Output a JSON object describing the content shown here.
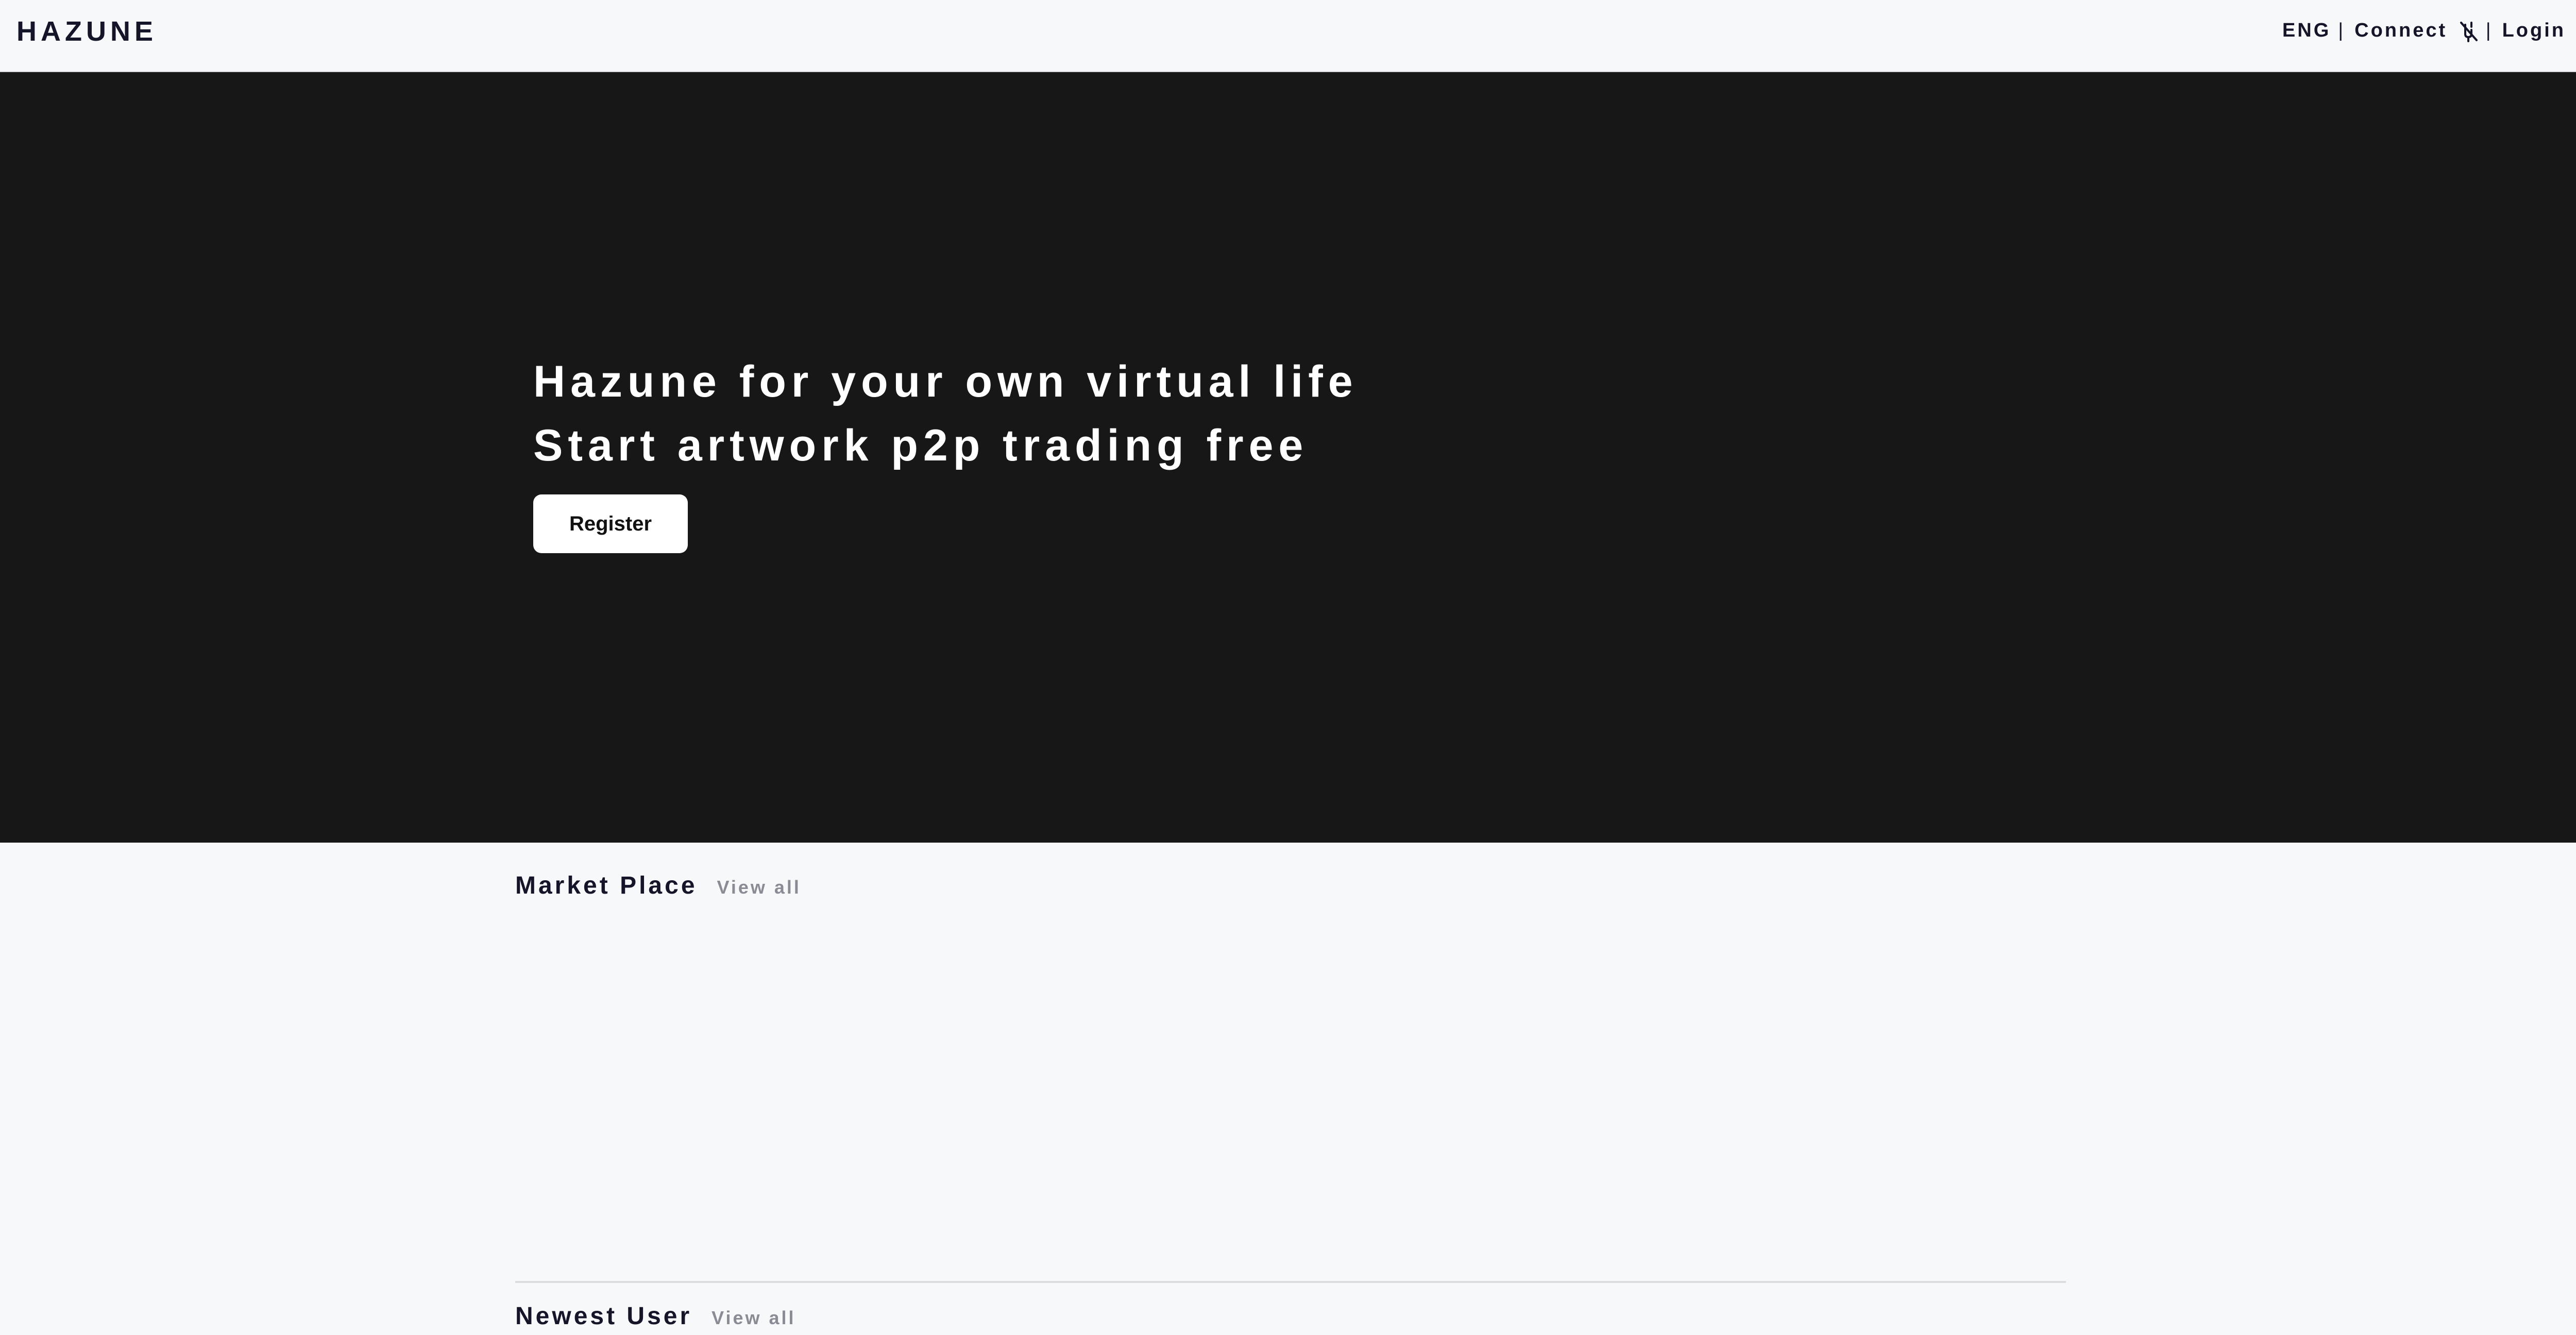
{
  "header": {
    "brand": "HAZUNE",
    "language": "ENG",
    "separator": "|",
    "connect_label": "Connect",
    "connect_icon": "wallet-off-icon",
    "login_label": "Login"
  },
  "hero": {
    "headline_1": "Hazune for your own virtual life",
    "headline_2": "Start artwork p2p trading free",
    "register_label": "Register"
  },
  "sections": {
    "market": {
      "title": "Market Place",
      "view_all": "View all"
    },
    "newest_user": {
      "title": "Newest User",
      "view_all": "View all"
    }
  },
  "colors": {
    "page_background": "#f7f8fa",
    "hero_background": "#171717",
    "text_primary": "#15152a",
    "text_muted": "#8a8b95",
    "button_background": "#ffffff"
  }
}
